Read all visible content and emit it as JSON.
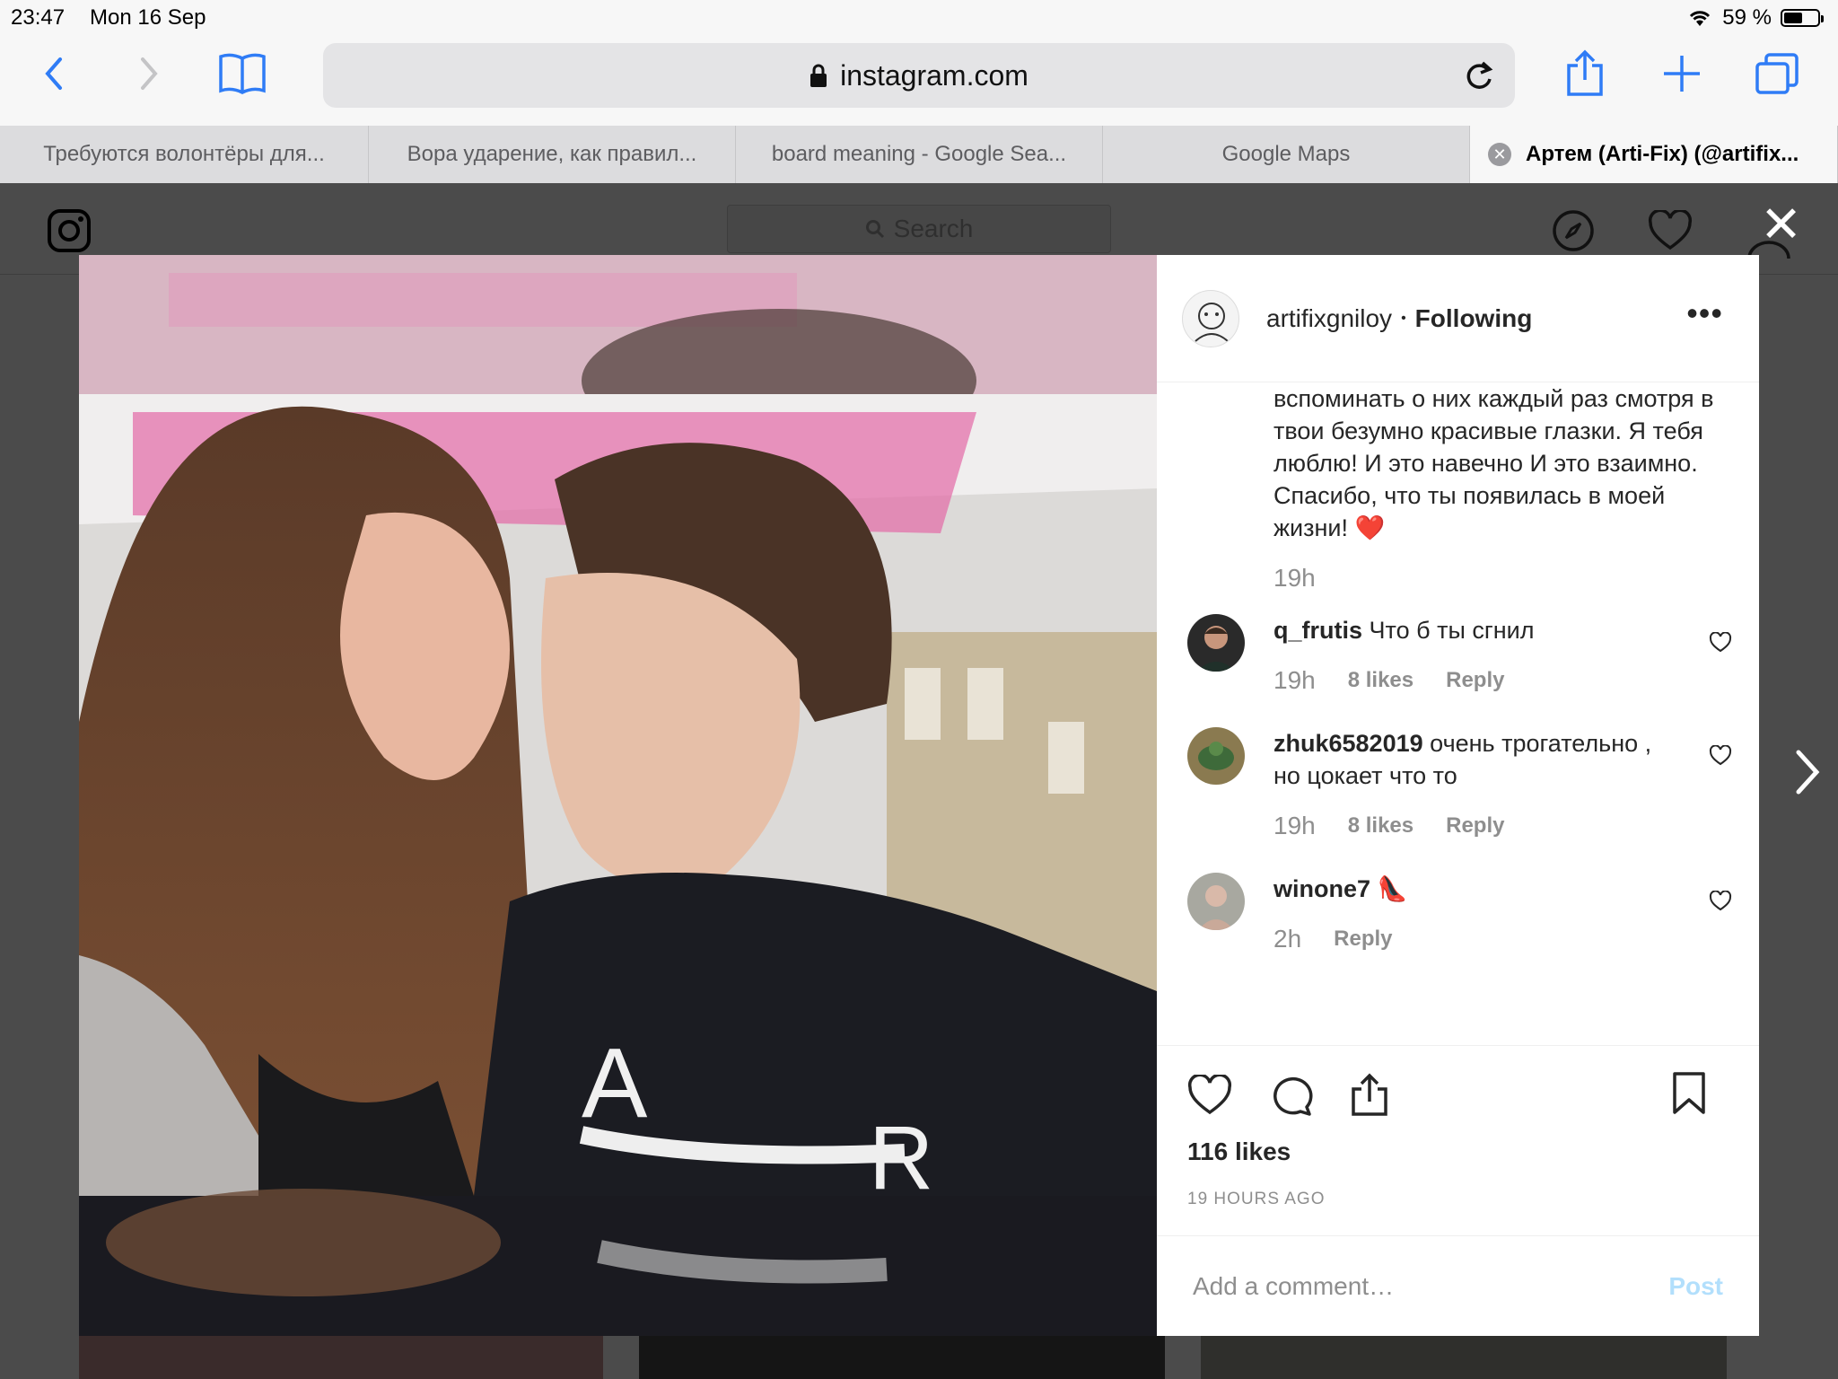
{
  "status": {
    "time": "23:47",
    "date": "Mon 16 Sep",
    "battery": "59 %",
    "battery_level": 0.59
  },
  "browser": {
    "url": "instagram.com",
    "tabs": [
      {
        "label": "Требуются волонтёры для..."
      },
      {
        "label": "Вора ударение, как правил..."
      },
      {
        "label": "board meaning - Google Sea..."
      },
      {
        "label": "Google Maps"
      },
      {
        "label": "Артем (Arti-Fix) (@artifix..."
      }
    ]
  },
  "ig": {
    "search_placeholder": "Search"
  },
  "post": {
    "username": "artifixgniloy",
    "separator": "•",
    "follow_status": "Following",
    "more": "•••",
    "caption": "вспоминать о них каждый раз смотря в твои безумно красивые глазки. Я тебя люблю! И это навечно И это взаимно. Спасибо, что ты появилась в моей жизни! ❤️",
    "caption_time": "19h",
    "comments": [
      {
        "user": "q_frutis",
        "text": "Что б ты сгнил",
        "time": "19h",
        "likes": "8 likes",
        "reply": "Reply"
      },
      {
        "user": "zhuk6582019",
        "text": "очень трогательно , но цокает что то",
        "time": "19h",
        "likes": "8 likes",
        "reply": "Reply"
      },
      {
        "user": "winone7",
        "text": "👠",
        "time": "2h",
        "reply": "Reply"
      }
    ],
    "likes": "116 likes",
    "posted": "19 HOURS AGO",
    "add_comment_placeholder": "Add a comment…",
    "post_button": "Post"
  }
}
